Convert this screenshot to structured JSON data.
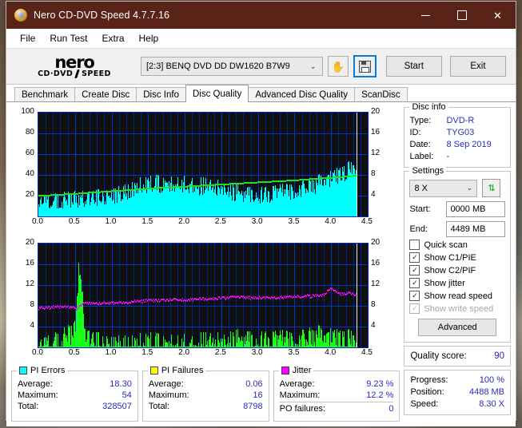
{
  "window": {
    "title": "Nero CD-DVD Speed 4.7.7.16",
    "icon": "nero-disc-icon",
    "minimize": "—",
    "maximize": "□",
    "close": "✕"
  },
  "menu": [
    "File",
    "Run Test",
    "Extra",
    "Help"
  ],
  "logo": {
    "word": "nero",
    "sub_left": "CD·DVD",
    "sub_right": "SPEED"
  },
  "toolbar": {
    "drive": "[2:3]   BENQ DVD DD DW1620 B7W9",
    "drive_caret": "⌄",
    "eject_icon": "hand-disc-icon",
    "save_icon": "floppy-save-icon",
    "start_label": "Start",
    "exit_label": "Exit"
  },
  "tabs": [
    {
      "label": "Benchmark",
      "active": false
    },
    {
      "label": "Create Disc",
      "active": false
    },
    {
      "label": "Disc Info",
      "active": false
    },
    {
      "label": "Disc Quality",
      "active": true
    },
    {
      "label": "Advanced Disc Quality",
      "active": false
    },
    {
      "label": "ScanDisc",
      "active": false
    }
  ],
  "disc_info": {
    "title": "Disc info",
    "rows": [
      {
        "key": "Type:",
        "value": "DVD-R"
      },
      {
        "key": "ID:",
        "value": "TYG03"
      },
      {
        "key": "Date:",
        "value": "8 Sep 2019"
      },
      {
        "key": "Label:",
        "value": "-"
      }
    ]
  },
  "settings": {
    "title": "Settings",
    "speed": "8 X",
    "speed_caret": "⌄",
    "refresh_icon": "refresh-icon",
    "start_label": "Start:",
    "start_value": "0000 MB",
    "end_label": "End:",
    "end_value": "4489 MB",
    "checkboxes": [
      {
        "label": "Quick scan",
        "checked": false,
        "disabled": false
      },
      {
        "label": "Show C1/PIE",
        "checked": true,
        "disabled": false
      },
      {
        "label": "Show C2/PIF",
        "checked": true,
        "disabled": false
      },
      {
        "label": "Show jitter",
        "checked": true,
        "disabled": false
      },
      {
        "label": "Show read speed",
        "checked": true,
        "disabled": false
      },
      {
        "label": "Show write speed",
        "checked": true,
        "disabled": true
      }
    ],
    "advanced_label": "Advanced"
  },
  "quality": {
    "label": "Quality score:",
    "value": "90"
  },
  "progress": {
    "rows": [
      {
        "key": "Progress:",
        "value": "100 %"
      },
      {
        "key": "Position:",
        "value": "4488 MB"
      },
      {
        "key": "Speed:",
        "value": "8.30 X"
      }
    ]
  },
  "stats": [
    {
      "title": "PI Errors",
      "color": "#00ffff",
      "rows": [
        {
          "key": "Average:",
          "value": "18.30"
        },
        {
          "key": "Maximum:",
          "value": "54"
        },
        {
          "key": "Total:",
          "value": "328507"
        }
      ]
    },
    {
      "title": "PI Failures",
      "color": "#ffff00",
      "rows": [
        {
          "key": "Average:",
          "value": "0.06"
        },
        {
          "key": "Maximum:",
          "value": "16"
        },
        {
          "key": "Total:",
          "value": "8798"
        }
      ]
    },
    {
      "title": "Jitter",
      "color": "#ff00ff",
      "rows": [
        {
          "key": "Average:",
          "value": "9.23 %"
        },
        {
          "key": "Maximum:",
          "value": "12.2 %"
        }
      ],
      "extra_row": {
        "key": "PO failures:",
        "value": "0"
      }
    }
  ],
  "chart_data": [
    {
      "type": "area",
      "id": "pi-errors-chart",
      "title": "PI Errors / Read speed",
      "xlabel": "",
      "ylabel": "PI Errors",
      "xlim": [
        0.0,
        4.5
      ],
      "ylim": [
        0,
        100
      ],
      "y2lim": [
        0,
        20
      ],
      "grid": true,
      "xticks": [
        "0.0",
        "0.5",
        "1.0",
        "1.5",
        "2.0",
        "2.5",
        "3.0",
        "3.5",
        "4.0",
        "4.5"
      ],
      "yticks_left": [
        "20",
        "40",
        "60",
        "80",
        "100"
      ],
      "yticks_right": [
        "4",
        "8",
        "12",
        "16",
        "20"
      ],
      "scan_end_gb": 4.35,
      "series": [
        {
          "name": "PI Errors",
          "color": "#00ffff",
          "style": "filled-spikes",
          "baseline": [
            {
              "x": 0.0,
              "y": 15
            },
            {
              "x": 0.2,
              "y": 14
            },
            {
              "x": 0.4,
              "y": 15
            },
            {
              "x": 0.6,
              "y": 16
            },
            {
              "x": 0.8,
              "y": 18
            },
            {
              "x": 1.0,
              "y": 20
            },
            {
              "x": 1.2,
              "y": 24
            },
            {
              "x": 1.4,
              "y": 29
            },
            {
              "x": 1.6,
              "y": 31
            },
            {
              "x": 1.8,
              "y": 31
            },
            {
              "x": 2.0,
              "y": 31
            },
            {
              "x": 2.2,
              "y": 29
            },
            {
              "x": 2.4,
              "y": 27
            },
            {
              "x": 2.6,
              "y": 24
            },
            {
              "x": 2.8,
              "y": 22
            },
            {
              "x": 3.0,
              "y": 21
            },
            {
              "x": 3.2,
              "y": 22
            },
            {
              "x": 3.4,
              "y": 24
            },
            {
              "x": 3.6,
              "y": 27
            },
            {
              "x": 3.8,
              "y": 31
            },
            {
              "x": 4.0,
              "y": 36
            },
            {
              "x": 4.15,
              "y": 41
            },
            {
              "x": 4.25,
              "y": 45
            },
            {
              "x": 4.35,
              "y": 47
            }
          ],
          "noise": 9
        },
        {
          "name": "Read speed",
          "color": "#22dd22",
          "style": "line",
          "axis": "right",
          "points": [
            {
              "x": 0.0,
              "y": 4.1
            },
            {
              "x": 0.5,
              "y": 4.5
            },
            {
              "x": 1.0,
              "y": 5.0
            },
            {
              "x": 1.5,
              "y": 5.5
            },
            {
              "x": 2.0,
              "y": 5.9
            },
            {
              "x": 2.5,
              "y": 6.3
            },
            {
              "x": 3.0,
              "y": 6.7
            },
            {
              "x": 3.5,
              "y": 7.1
            },
            {
              "x": 4.0,
              "y": 7.6
            },
            {
              "x": 4.35,
              "y": 8.0
            }
          ]
        }
      ]
    },
    {
      "type": "area",
      "id": "pi-failures-chart",
      "title": "PI Failures / Jitter",
      "xlabel": "",
      "ylabel": "PI Failures",
      "xlim": [
        0.0,
        4.5
      ],
      "ylim": [
        0,
        20
      ],
      "y2lim": [
        0,
        20
      ],
      "grid": true,
      "xticks": [
        "0.0",
        "0.5",
        "1.0",
        "1.5",
        "2.0",
        "2.5",
        "3.0",
        "3.5",
        "4.0",
        "4.5"
      ],
      "yticks_left": [
        "4",
        "8",
        "12",
        "16",
        "20"
      ],
      "yticks_right": [
        "4",
        "8",
        "12",
        "16",
        "20"
      ],
      "scan_end_gb": 4.35,
      "series": [
        {
          "name": "PI Failures",
          "color": "#1aff1a",
          "style": "spikes",
          "baseline": [
            {
              "x": 0.0,
              "y": 0.6
            },
            {
              "x": 0.25,
              "y": 0.9
            },
            {
              "x": 0.5,
              "y": 3.0
            },
            {
              "x": 0.55,
              "y": 16.0
            },
            {
              "x": 0.65,
              "y": 1.6
            },
            {
              "x": 0.9,
              "y": 0.7
            },
            {
              "x": 1.2,
              "y": 0.4
            },
            {
              "x": 1.5,
              "y": 0.7
            },
            {
              "x": 1.8,
              "y": 0.5
            },
            {
              "x": 2.1,
              "y": 0.6
            },
            {
              "x": 2.4,
              "y": 0.8
            },
            {
              "x": 2.6,
              "y": 0.9
            },
            {
              "x": 2.8,
              "y": 1.7
            },
            {
              "x": 3.0,
              "y": 1.2
            },
            {
              "x": 3.2,
              "y": 1.3
            },
            {
              "x": 3.5,
              "y": 1.3
            },
            {
              "x": 3.8,
              "y": 2.2
            },
            {
              "x": 4.0,
              "y": 1.6
            },
            {
              "x": 4.2,
              "y": 1.5
            },
            {
              "x": 4.35,
              "y": 1.4
            }
          ],
          "noise": 2.2,
          "peak": {
            "x": 0.53,
            "y": 16.0
          }
        },
        {
          "name": "Jitter",
          "color": "#ff00ff",
          "style": "line",
          "points": [
            {
              "x": 0.0,
              "y": 7.7
            },
            {
              "x": 0.2,
              "y": 7.9
            },
            {
              "x": 0.4,
              "y": 8.0
            },
            {
              "x": 0.52,
              "y": 7.6
            },
            {
              "x": 0.6,
              "y": 8.6
            },
            {
              "x": 0.9,
              "y": 8.7
            },
            {
              "x": 1.2,
              "y": 8.8
            },
            {
              "x": 1.5,
              "y": 9.2
            },
            {
              "x": 1.8,
              "y": 9.3
            },
            {
              "x": 2.1,
              "y": 9.4
            },
            {
              "x": 2.4,
              "y": 9.6
            },
            {
              "x": 2.7,
              "y": 9.8
            },
            {
              "x": 3.0,
              "y": 9.7
            },
            {
              "x": 3.3,
              "y": 9.8
            },
            {
              "x": 3.6,
              "y": 9.9
            },
            {
              "x": 3.9,
              "y": 10.2
            },
            {
              "x": 4.0,
              "y": 11.6
            },
            {
              "x": 4.1,
              "y": 10.4
            },
            {
              "x": 4.25,
              "y": 10.6
            },
            {
              "x": 4.35,
              "y": 10.2
            }
          ]
        }
      ]
    }
  ]
}
